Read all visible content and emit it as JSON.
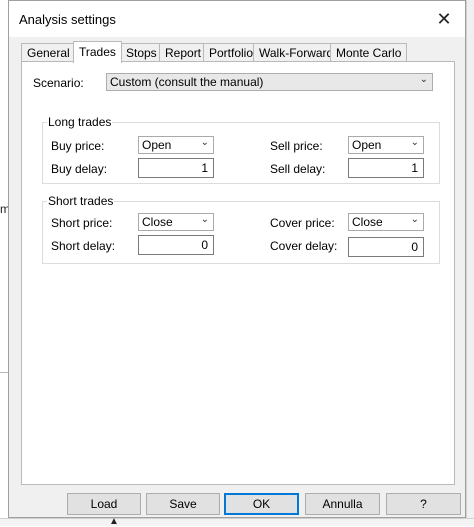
{
  "background": {
    "left_fragment": "m"
  },
  "dialog": {
    "title": "Analysis settings",
    "close_glyph": "✕"
  },
  "tabs": [
    {
      "label": "General"
    },
    {
      "label": "Trades"
    },
    {
      "label": "Stops"
    },
    {
      "label": "Report"
    },
    {
      "label": "Portfolio"
    },
    {
      "label": "Walk-Forward"
    },
    {
      "label": "Monte Carlo"
    }
  ],
  "active_tab": "Trades",
  "scenario": {
    "label": "Scenario:",
    "value": "Custom (consult the manual)"
  },
  "long_trades": {
    "title": "Long trades",
    "buy_price_label": "Buy price:",
    "buy_price_value": "Open",
    "buy_delay_label": "Buy delay:",
    "buy_delay_value": "1",
    "sell_price_label": "Sell price:",
    "sell_price_value": "Open",
    "sell_delay_label": "Sell delay:",
    "sell_delay_value": "1"
  },
  "short_trades": {
    "title": "Short trades",
    "short_price_label": "Short price:",
    "short_price_value": "Close",
    "short_delay_label": "Short delay:",
    "short_delay_value": "0",
    "cover_price_label": "Cover price:",
    "cover_price_value": "Close",
    "cover_delay_label": "Cover delay:",
    "cover_delay_value": "0"
  },
  "buttons": {
    "load": "Load",
    "save": "Save",
    "ok": "OK",
    "cancel": "Annulla",
    "help": "?"
  },
  "icons": {
    "dropdown": "chevron-down-icon",
    "close": "close-icon"
  },
  "colors": {
    "accent": "#0078d7",
    "dialog_bg": "#f0f0f0",
    "panel_bg": "#ffffff"
  }
}
